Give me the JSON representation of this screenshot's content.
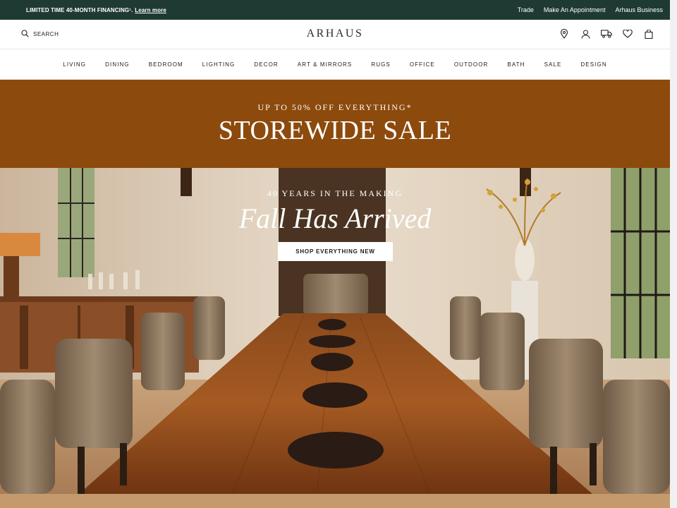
{
  "promo": {
    "text": "LIMITED TIME 40-MONTH FINANCING¹.",
    "link": "Learn more",
    "right_links": [
      "Trade",
      "Make An Appointment",
      "Arhaus Business"
    ]
  },
  "header": {
    "search_label": "SEARCH",
    "logo": "ARHAUS",
    "icons": [
      "location-pin-icon",
      "account-icon",
      "delivery-truck-icon",
      "heart-icon",
      "shopping-bag-icon"
    ]
  },
  "nav": {
    "items": [
      "LIVING",
      "DINING",
      "BEDROOM",
      "LIGHTING",
      "DECOR",
      "ART & MIRRORS",
      "RUGS",
      "OFFICE",
      "OUTDOOR",
      "BATH",
      "SALE",
      "DESIGN"
    ]
  },
  "sale": {
    "subtitle": "UP TO 50% OFF EVERYTHING*",
    "title": "STOREWIDE SALE",
    "color": "#8c4a0d"
  },
  "hero": {
    "eyebrow": "40 YEARS IN THE MAKING",
    "headline": "Fall Has Arrived",
    "cta": "SHOP EVERYTHING NEW"
  },
  "colors": {
    "promo_bg": "#1f3a33",
    "sale_bg": "#8c4a0d"
  }
}
